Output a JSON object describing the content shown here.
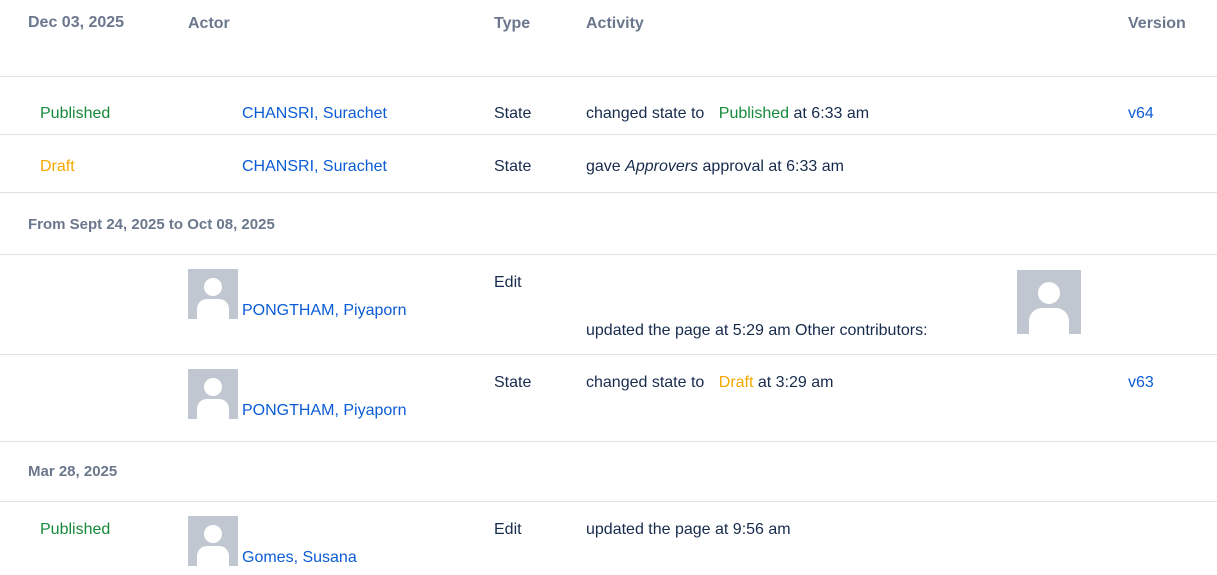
{
  "header": {
    "date_col": "Dec 03, 2025",
    "actor_col": "Actor",
    "type_col": "Type",
    "activity_col": "Activity",
    "version_col": "Version"
  },
  "rows": [
    {
      "state": "Published",
      "actor": "CHANSRI, Surachet",
      "type": "State",
      "activity_prefix": "changed state to",
      "activity_state": "Published",
      "activity_suffix": "at 6:33 am",
      "version": "v64"
    },
    {
      "state": "Draft",
      "actor": "CHANSRI, Surachet",
      "type": "State",
      "activity_prefix": "gave",
      "activity_italic": "Approvers",
      "activity_suffix": "approval at 6:33 am"
    }
  ],
  "group2": {
    "label": "From Sept 24, 2025 to Oct 08, 2025",
    "rows": [
      {
        "actor": "PONGTHAM, Piyaporn",
        "type": "Edit",
        "activity": "updated the page at 5:29 am Other contributors:"
      },
      {
        "actor": "PONGTHAM, Piyaporn",
        "type": "State",
        "activity_prefix": "changed state to",
        "activity_state": "Draft",
        "activity_suffix": "at 3:29 am",
        "version": "v63"
      }
    ]
  },
  "group3": {
    "label": "Mar 28, 2025",
    "rows": [
      {
        "state": "Published",
        "actor": "Gomes, Susana",
        "type": "Edit",
        "activity": "updated the page at 9:56 am"
      }
    ]
  }
}
